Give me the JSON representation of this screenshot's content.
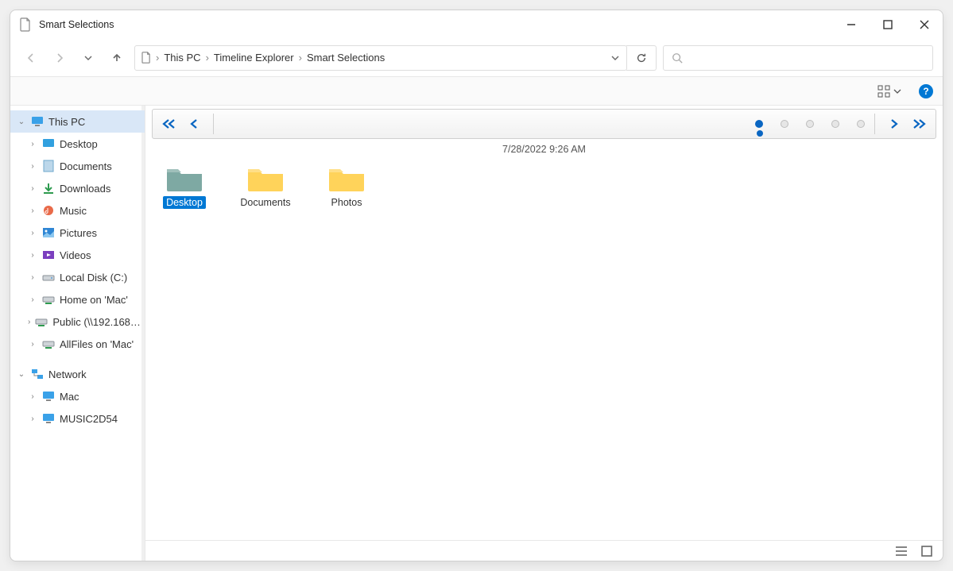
{
  "window": {
    "title": "Smart Selections"
  },
  "breadcrumb": {
    "parts": [
      "This PC",
      "Timeline Explorer",
      "Smart Selections"
    ]
  },
  "search": {
    "placeholder": ""
  },
  "timeline": {
    "timestamp": "7/28/2022 9:26 AM"
  },
  "tree": {
    "thispc": {
      "label": "This PC",
      "children": {
        "desktop": {
          "label": "Desktop"
        },
        "documents": {
          "label": "Documents"
        },
        "downloads": {
          "label": "Downloads"
        },
        "music": {
          "label": "Music"
        },
        "pictures": {
          "label": "Pictures"
        },
        "videos": {
          "label": "Videos"
        },
        "localdisk": {
          "label": "Local Disk (C:)"
        },
        "home": {
          "label": "Home on 'Mac'"
        },
        "public": {
          "label": "Public (\\\\192.168…"
        },
        "allfiles": {
          "label": "AllFiles on 'Mac'"
        }
      }
    },
    "network": {
      "label": "Network",
      "children": {
        "mac": {
          "label": "Mac"
        },
        "music2d54": {
          "label": "MUSIC2D54"
        }
      }
    }
  },
  "folders": [
    {
      "name": "Desktop",
      "selected": true,
      "tint": "teal"
    },
    {
      "name": "Documents",
      "selected": false,
      "tint": "yellow"
    },
    {
      "name": "Photos",
      "selected": false,
      "tint": "yellow"
    }
  ],
  "colors": {
    "accent": "#0078d4",
    "timelineBlue": "#0a66c2"
  }
}
